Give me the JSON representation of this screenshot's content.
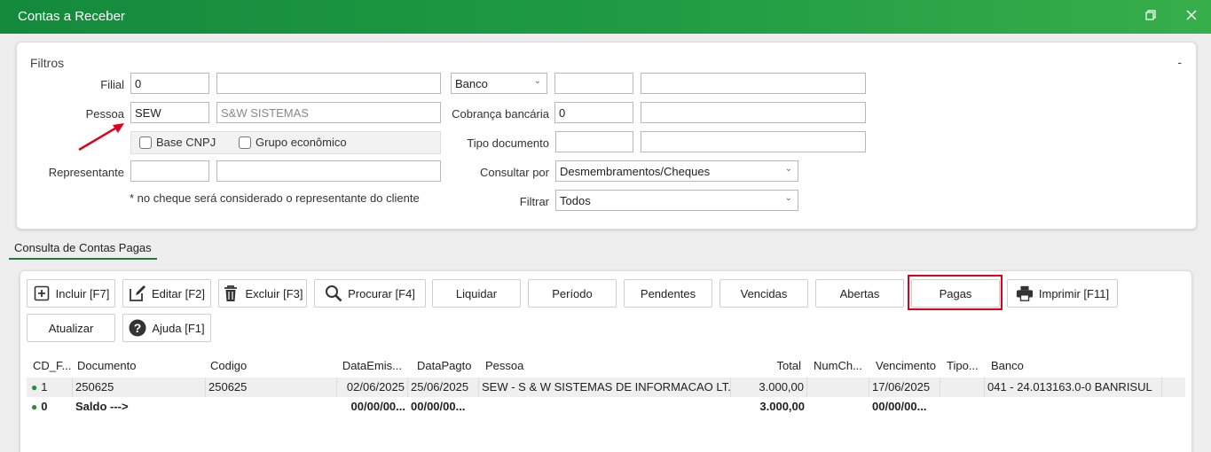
{
  "window": {
    "title": "Contas a Receber"
  },
  "filters": {
    "legend": "Filtros",
    "collapse": "-",
    "filial": {
      "label": "Filial",
      "code": "0",
      "name": ""
    },
    "pessoa": {
      "label": "Pessoa",
      "code": "SEW",
      "name": "S&W SISTEMAS"
    },
    "base_cnpj": "Base CNPJ",
    "grupo_economico": "Grupo econômico",
    "representante": {
      "label": "Representante",
      "code": "",
      "name": ""
    },
    "note": "* no cheque será considerado o representante do cliente",
    "banco": {
      "label": "Banco",
      "code": "",
      "name": ""
    },
    "cobranca": {
      "label": "Cobrança bancária",
      "code": "0",
      "name": ""
    },
    "tipo_documento": {
      "label": "Tipo documento",
      "code": "",
      "name": ""
    },
    "consultar_por": {
      "label": "Consultar por",
      "value": "Desmembramentos/Cheques"
    },
    "filtrar": {
      "label": "Filtrar",
      "value": "Todos"
    }
  },
  "tab": {
    "label": "Consulta de Contas Pagas"
  },
  "toolbar": {
    "incluir": "Incluir [F7]",
    "editar": "Editar [F2]",
    "excluir": "Excluir [F3]",
    "procurar": "Procurar [F4]",
    "liquidar": "Liquidar",
    "periodo": "Período",
    "pendentes": "Pendentes",
    "vencidas": "Vencidas",
    "abertas": "Abertas",
    "pagas": "Pagas",
    "imprimir": "Imprimir [F11]",
    "atualizar": "Atualizar",
    "ajuda": "Ajuda [F1]"
  },
  "grid": {
    "columns": [
      "CD_F...",
      "Documento",
      "Codigo",
      "DataEmis...",
      "DataPagto",
      "Pessoa",
      "Total",
      "NumCh...",
      "Vencimento",
      "Tipo...",
      "Banco"
    ],
    "rows": [
      {
        "cd": "1",
        "documento": "250625",
        "codigo": "250625",
        "data_emis": "02/06/2025",
        "data_pagto": "25/06/2025",
        "pessoa": "SEW - S & W SISTEMAS DE INFORMACAO LT...",
        "total": "3.000,00",
        "num_ch": "",
        "vencimento": "17/06/2025",
        "tipo": "",
        "banco": "041 - 24.013163.0-0 BANRISUL"
      },
      {
        "cd": "0",
        "documento": "Saldo --->",
        "codigo": "",
        "data_emis": "00/00/00...",
        "data_pagto": "00/00/00...",
        "pessoa": "",
        "total": "3.000,00",
        "num_ch": "",
        "vencimento": "00/00/00...",
        "tipo": "",
        "banco": ""
      }
    ]
  },
  "colors": {
    "accent": "#1f9a43",
    "highlight": "#e0001b",
    "annotation_arrow": "#e0001b"
  }
}
